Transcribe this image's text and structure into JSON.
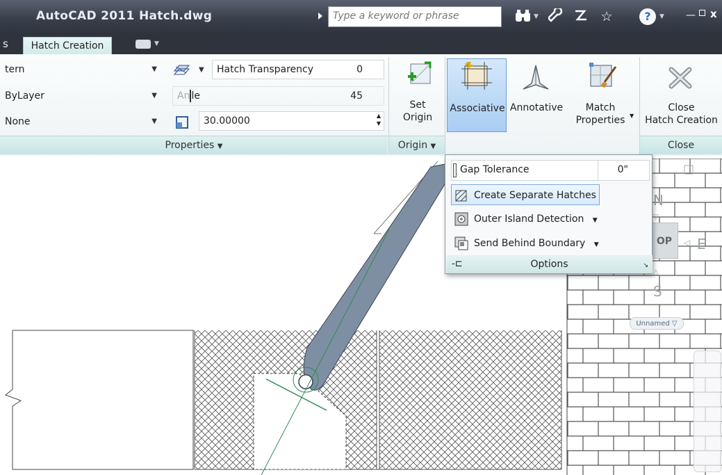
{
  "titlebar": {
    "app": "AutoCAD 2011",
    "file": "Hatch.dwg",
    "search_placeholder": "Type a keyword or phrase",
    "icons": [
      "binoculars-icon",
      "wrench-icon",
      "satellite-icon",
      "star-icon",
      "help-icon"
    ]
  },
  "tabs": {
    "prev_fragment": "s",
    "active": "Hatch Creation"
  },
  "properties_panel": {
    "pattern_combo": "tern",
    "color_combo": "ByLayer",
    "background_combo": "None",
    "transparency_label": "Hatch Transparency",
    "transparency_value": "0",
    "angle_label_a": "An",
    "angle_label_b": "le",
    "angle_value": "45",
    "scale_value": "30.00000",
    "label": "Properties"
  },
  "origin_panel": {
    "set_origin_line1": "Set",
    "set_origin_line2": "Origin",
    "label": "Origin"
  },
  "options_panel": {
    "associative": "Associative",
    "annotative": "Annotative",
    "match_line1": "Match",
    "match_line2": "Properties"
  },
  "close_panel": {
    "close_line1": "Close",
    "close_line2": "Hatch Creation",
    "label": "Close"
  },
  "options_menu": {
    "gap_label": "Gap Tolerance",
    "gap_value": "0\"",
    "create_separate": "Create Separate Hatches",
    "outer_island": "Outer Island Detection",
    "send_behind": "Send Behind Boundary",
    "footer": "Options"
  },
  "viewcube": {
    "north": "N",
    "south": "S",
    "east": "E",
    "top": "OP",
    "ucs": "Unnamed"
  },
  "colors": {
    "ribbon_accent": "#c7e4e4",
    "associative_active": "#b9d7f7",
    "hatch_stroke": "#555555",
    "pen_fill": "#7f8fa3"
  }
}
